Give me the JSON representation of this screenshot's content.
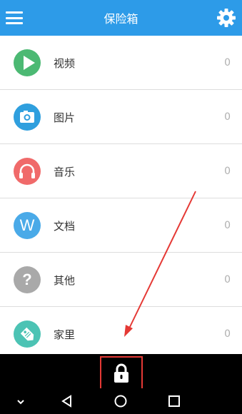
{
  "header": {
    "title": "保险箱",
    "menu_icon": "hamburger-menu-icon",
    "settings_icon": "gear-icon",
    "color": "#2d9be8"
  },
  "list": {
    "items": [
      {
        "label": "视频",
        "count": "0",
        "icon": "play-icon",
        "color": "#4cb973"
      },
      {
        "label": "图片",
        "count": "0",
        "icon": "camera-icon",
        "color": "#2f9fde"
      },
      {
        "label": "音乐",
        "count": "0",
        "icon": "headphones-icon",
        "color": "#f06a6a"
      },
      {
        "label": "文档",
        "count": "0",
        "icon": "document-w-icon",
        "icon_text": "W",
        "color": "#4aaae8"
      },
      {
        "label": "其他",
        "count": "0",
        "icon": "question-icon",
        "icon_text": "?",
        "color": "#a9a9a9"
      },
      {
        "label": "家里",
        "count": "0",
        "icon": "tag-icon",
        "color": "#4cc3b4"
      }
    ]
  },
  "bottom_bar": {
    "lock_icon": "lock-icon",
    "highlight_color": "#e53935"
  },
  "nav_bar": {
    "buttons": [
      "chevron-down-icon",
      "back-triangle-icon",
      "home-circle-icon",
      "recents-square-icon"
    ]
  }
}
